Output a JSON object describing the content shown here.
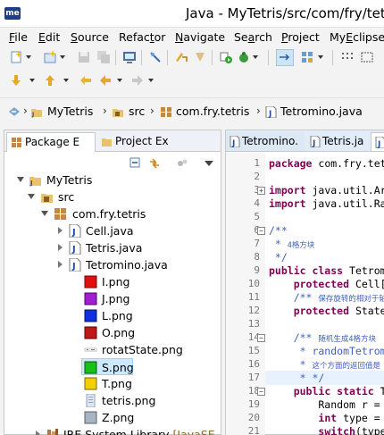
{
  "window": {
    "app_logo": "me",
    "title": "Java - MyTetris/src/com/fry/tetris"
  },
  "menu": {
    "items": [
      {
        "u": "F",
        "rest": "ile"
      },
      {
        "u": "E",
        "rest": "dit"
      },
      {
        "u": "S",
        "rest": "ource"
      },
      {
        "pre": "Refac",
        "u": "t",
        "rest": "or"
      },
      {
        "u": "N",
        "rest": "avigate"
      },
      {
        "pre": "Se",
        "u": "a",
        "rest": "rch"
      },
      {
        "u": "P",
        "rest": "roject"
      },
      {
        "pre": "My",
        "u": "E",
        "rest": "clipse"
      }
    ]
  },
  "breadcrumb": {
    "items": [
      "MyTetris",
      "src",
      "com.fry.tetris",
      "Tetromino.java"
    ]
  },
  "left_view": {
    "tabs": [
      {
        "label": "Package E",
        "active": true
      },
      {
        "label": "Project Ex",
        "active": false
      }
    ],
    "tree": [
      {
        "label": "MyTetris",
        "icon": "project-icon",
        "twisty": "open"
      },
      {
        "label": "src",
        "icon": "source-folder-icon",
        "twisty": "open"
      },
      {
        "label": "com.fry.tetris",
        "icon": "package-icon",
        "twisty": "open"
      },
      {
        "label": "Cell.java",
        "icon": "java-file-icon",
        "twisty": "closed"
      },
      {
        "label": "Tetris.java",
        "icon": "java-file-icon",
        "twisty": "closed"
      },
      {
        "label": "Tetromino.java",
        "icon": "java-file-icon",
        "twisty": "closed"
      },
      {
        "label": "I.png",
        "icon": "red-png-icon",
        "twisty": ""
      },
      {
        "label": "J.png",
        "icon": "purple-png-icon",
        "twisty": ""
      },
      {
        "label": "L.png",
        "icon": "blue-png-icon",
        "twisty": ""
      },
      {
        "label": "O.png",
        "icon": "darkred-png-icon",
        "twisty": ""
      },
      {
        "label": "rotatState.png",
        "icon": "image-file-icon",
        "twisty": ""
      },
      {
        "label": "S.png",
        "icon": "green-png-icon",
        "twisty": "",
        "selected": true
      },
      {
        "label": "T.png",
        "icon": "yellow-png-icon",
        "twisty": ""
      },
      {
        "label": "tetris.png",
        "icon": "image-file-icon",
        "twisty": ""
      },
      {
        "label": "Z.png",
        "icon": "grey-png-icon",
        "twisty": ""
      },
      {
        "label": "JRE System Library",
        "suffix": "[JavaSE",
        "icon": "library-icon",
        "twisty": "closed"
      }
    ]
  },
  "editor": {
    "tabs": [
      "Tetromino.",
      "Tetris.ja"
    ],
    "lines": [
      {
        "n": "1",
        "html": "<span class='kw'>package</span> com.fry.tet"
      },
      {
        "n": "2",
        "html": ""
      },
      {
        "n": "3",
        "html": "<span class='kw'>import</span> java.util.Ar",
        "fold": "+"
      },
      {
        "n": "4",
        "html": "<span class='kw'>import</span> java.util.Ra"
      },
      {
        "n": "5",
        "html": ""
      },
      {
        "n": "6",
        "html": "<span class='cm'>/**</span>",
        "fold": "-"
      },
      {
        "n": "7",
        "html": "<span class='cm'> * </span><span class='cmsmall'>4格方块</span>"
      },
      {
        "n": "8",
        "html": "<span class='cm'> */</span>"
      },
      {
        "n": "9",
        "html": "<span class='kw'>public class</span> Tetrom"
      },
      {
        "n": "10",
        "html": "    <span class='kw'>protected</span> Cell["
      },
      {
        "n": "11",
        "html": "    <span class='cm'>/** </span><span class='cmsmall'>保存旋转的相对于轴</span>"
      },
      {
        "n": "12",
        "html": "    <span class='kw'>protected</span> State"
      },
      {
        "n": "13",
        "html": ""
      },
      {
        "n": "14",
        "html": "    <span class='cm'>/** </span><span class='cmsmall'>随机生成4格方块</span>",
        "fold": "-"
      },
      {
        "n": "15",
        "html": "<span class='cm'>     * randomTetrom</span>"
      },
      {
        "n": "16",
        "html": "<span class='cm'>     * </span><span class='cmsmall'>这个方面的返回值是</span>"
      },
      {
        "n": "17",
        "html": "<span class='cm'>     * */</span>"
      },
      {
        "n": "18",
        "html": "    <span class='kw'>public static</span> T",
        "fold": "-"
      },
      {
        "n": "19",
        "html": "        Random r ="
      },
      {
        "n": "20",
        "html": "        <span class='kw'>int</span> type ="
      },
      {
        "n": "21",
        "html": "        <span class='kw'>switch</span>(type"
      }
    ]
  }
}
